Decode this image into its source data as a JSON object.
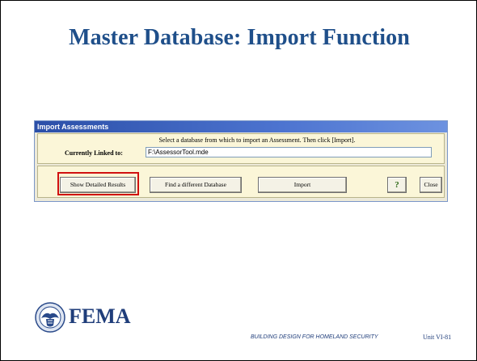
{
  "slide": {
    "title": "Master Database: Import Function"
  },
  "dialog": {
    "title": "Import Assessments",
    "instruction": "Select a database from which to import an Assessment.  Then click [Import].",
    "linked_label": "Currently Linked to:",
    "linked_value": "F:\\AssessorTool.mde",
    "buttons": {
      "show_detailed": "Show Detailed Results",
      "find_database": "Find a different Database",
      "import": "Import",
      "help_glyph": "?",
      "close": "Close"
    }
  },
  "footer": {
    "logo_text": "FEMA",
    "course": "BUILDING DESIGN FOR HOMELAND SECURITY",
    "unit": "Unit VI-81"
  },
  "colors": {
    "title": "#1f4f8a",
    "highlight": "#d01010",
    "titlebar": "#2b4fa8"
  }
}
